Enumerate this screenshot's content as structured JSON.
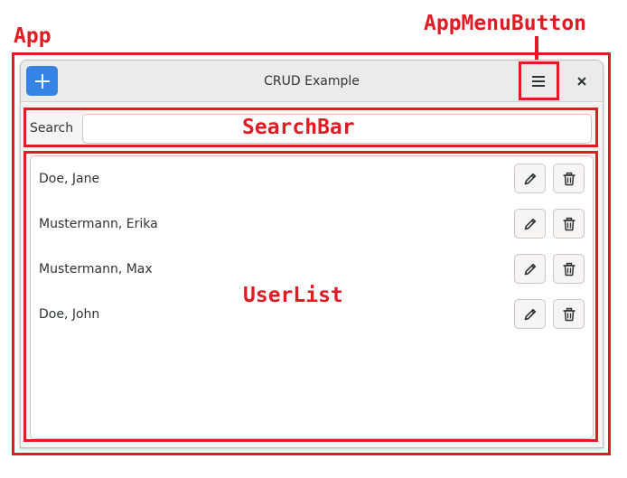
{
  "annotations": {
    "app": "App",
    "app_menu_button": "AppMenuButton",
    "search_bar": "SearchBar",
    "user_list": "UserList"
  },
  "window": {
    "title": "CRUD Example",
    "add_icon": "plus-icon",
    "menu_icon": "hamburger-menu-icon",
    "close_icon": "close-icon"
  },
  "search": {
    "label": "Search",
    "value": ""
  },
  "users": [
    {
      "name": "Doe, Jane"
    },
    {
      "name": "Mustermann, Erika"
    },
    {
      "name": "Mustermann, Max"
    },
    {
      "name": "Doe, John"
    }
  ],
  "row_actions": {
    "edit_icon": "pencil-icon",
    "delete_icon": "trash-icon"
  },
  "colors": {
    "annotation": "#e01b24",
    "accent": "#3584e4",
    "window_bg": "#f6f5f4"
  }
}
